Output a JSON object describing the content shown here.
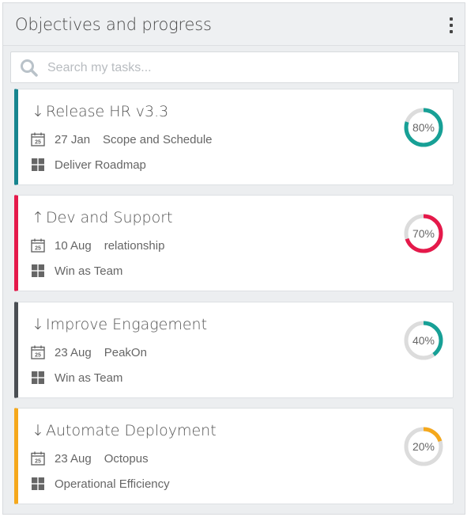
{
  "header": {
    "title": "Objectives and progress",
    "menu_icon": "kebab-menu-icon"
  },
  "search": {
    "placeholder": "Search my tasks...",
    "value": ""
  },
  "tasks": [
    {
      "arrow": "down",
      "arrow_glyph": "↓",
      "title": "Release HR v3.3",
      "date": "27 Jan",
      "category": "Scope and Schedule",
      "goal": "Deliver Roadmap",
      "progress": 80,
      "progress_label": "80%",
      "accent": "#17858f",
      "ring": "#17a096"
    },
    {
      "arrow": "up",
      "arrow_glyph": "↑",
      "title": "Dev and Support",
      "date": "10 Aug",
      "category": "relationship",
      "goal": "Win as Team",
      "progress": 70,
      "progress_label": "70%",
      "accent": "#e5194a",
      "ring": "#e5194a"
    },
    {
      "arrow": "down",
      "arrow_glyph": "↓",
      "title": "Improve Engagement",
      "date": "23 Aug",
      "category": "PeakOn",
      "goal": "Win as Team",
      "progress": 40,
      "progress_label": "40%",
      "accent": "#4a4e53",
      "ring": "#17a096"
    },
    {
      "arrow": "down",
      "arrow_glyph": "↓",
      "title": "Automate Deployment",
      "date": "23 Aug",
      "category": "Octopus",
      "goal": "Operational Efficiency",
      "progress": 20,
      "progress_label": "20%",
      "accent": "#f5a81c",
      "ring": "#f5a81c"
    }
  ],
  "calendar_day": "25",
  "colors": {
    "ring_track": "#dcdcdc"
  }
}
